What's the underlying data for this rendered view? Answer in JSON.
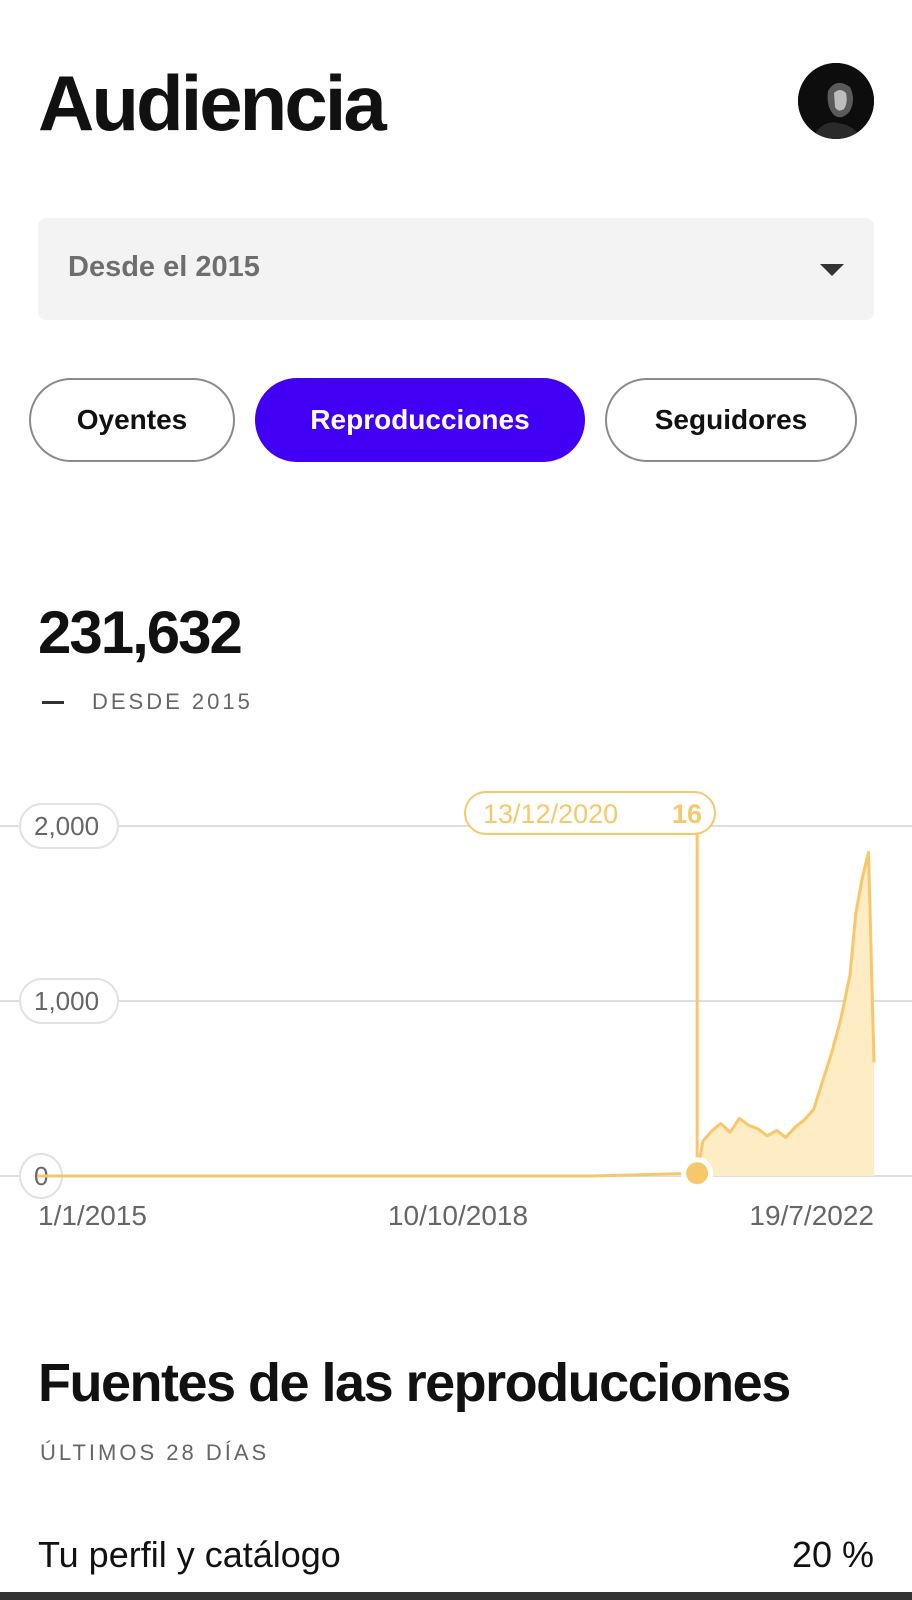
{
  "header": {
    "title": "Audiencia"
  },
  "filter": {
    "selected": "Desde el 2015"
  },
  "tabs": [
    {
      "label": "Oyentes",
      "active": false
    },
    {
      "label": "Reproducciones",
      "active": true
    },
    {
      "label": "Seguidores",
      "active": false
    }
  ],
  "summary": {
    "total": "231,632",
    "caption": "DESDE 2015"
  },
  "colors": {
    "accent": "#4100f4",
    "series": "#f7c76b",
    "series_fill": "#fdecc4"
  },
  "chart_data": {
    "type": "area",
    "y_ticks": [
      "0",
      "1,000",
      "2,000"
    ],
    "ylim": [
      0,
      2000
    ],
    "x_ticks": [
      "1/1/2015",
      "10/10/2018",
      "19/7/2022"
    ],
    "tooltip": {
      "date": "13/12/2020",
      "value": "16"
    },
    "series": [
      {
        "x": [
          "2015-01-01",
          "2016-01-01",
          "2017-01-01",
          "2018-01-01",
          "2019-01-01",
          "2020-01-01",
          "2020-12-13",
          "2021-01-01",
          "2021-02-01",
          "2021-03-01",
          "2021-04-01",
          "2021-05-01",
          "2021-06-01",
          "2021-07-01",
          "2021-08-01",
          "2021-09-01",
          "2021-10-01",
          "2021-11-01",
          "2021-12-01",
          "2022-01-01",
          "2022-02-01",
          "2022-03-01",
          "2022-04-01",
          "2022-05-01",
          "2022-05-20",
          "2022-06-10",
          "2022-07-01",
          "2022-07-19"
        ],
        "y": [
          0,
          0,
          0,
          0,
          0,
          0,
          16,
          200,
          260,
          300,
          250,
          330,
          290,
          270,
          230,
          260,
          220,
          280,
          320,
          380,
          550,
          700,
          900,
          1150,
          1500,
          1700,
          1850,
          650
        ]
      }
    ]
  },
  "sources": {
    "title": "Fuentes de las reproducciones",
    "caption": "ÚLTIMOS 28 DÍAS",
    "items": [
      {
        "label": "Tu perfil y catálogo",
        "value": "20 %"
      }
    ]
  }
}
